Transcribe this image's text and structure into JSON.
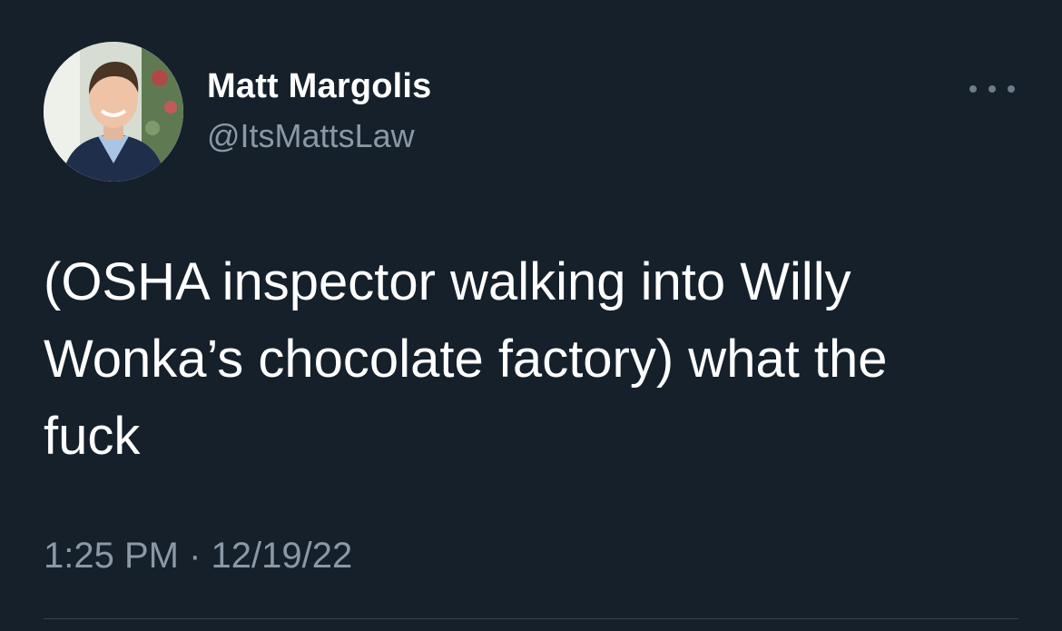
{
  "tweet": {
    "author": {
      "display_name": "Matt Margolis",
      "handle": "@ItsMattsLaw"
    },
    "text": "(OSHA inspector walking into Willy\nWonka’s chocolate factory) what the\nfuck",
    "time": "1:25 PM",
    "separator": "·",
    "date": "12/19/22",
    "icons": {
      "more": "more-horizontal-icon",
      "avatar": "profile-photo"
    }
  },
  "colors": {
    "background": "#15202b",
    "primary_text": "#ffffff",
    "secondary_text": "#8b98a5",
    "divider": "#38444d"
  }
}
